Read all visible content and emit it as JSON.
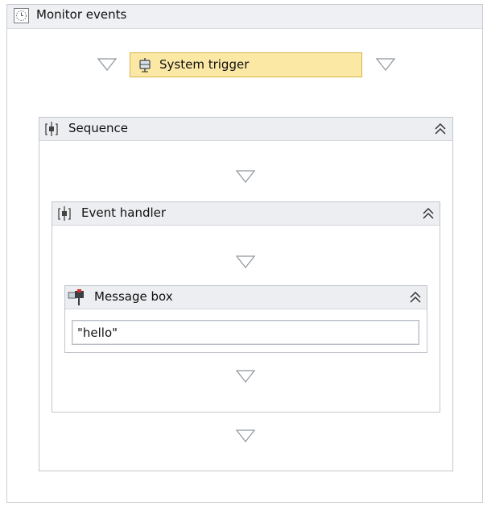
{
  "outer": {
    "title": "Monitor events",
    "icon": "clock-icon"
  },
  "trigger": {
    "label": "System trigger",
    "icon": "system-trigger-icon",
    "highlight_color": "#fbe8a5"
  },
  "sequence": {
    "title": "Sequence",
    "icon": "sequence-icon",
    "collapse_icon": "collapse-icon"
  },
  "event_handler": {
    "title": "Event handler",
    "icon": "event-handler-icon",
    "collapse_icon": "collapse-icon"
  },
  "message_box": {
    "title": "Message box",
    "icon": "message-box-icon",
    "collapse_icon": "collapse-icon",
    "value": "\"hello\""
  },
  "drop_target_icon": "drop-arrow-icon"
}
